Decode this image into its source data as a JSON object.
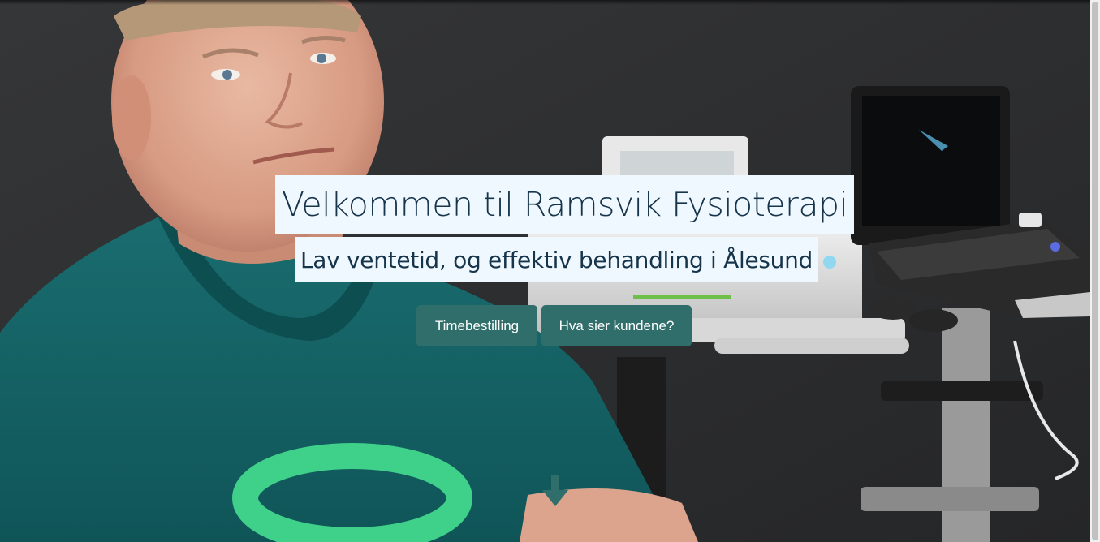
{
  "hero": {
    "title": "Velkommen til Ramsvik Fysioterapi",
    "subtitle": "Lav ventetid, og effektiv behandling i Ålesund",
    "buttons": {
      "booking": "Timebestilling",
      "reviews": "Hva sier kundene?"
    },
    "scroll_icon": "arrow-down-icon"
  },
  "colors": {
    "button_bg": "#2f6e6a",
    "heading_text": "#16344a",
    "heading_bg": "#f0f8ff",
    "shirt": "#145f62",
    "logo_green": "#3fd08a"
  }
}
